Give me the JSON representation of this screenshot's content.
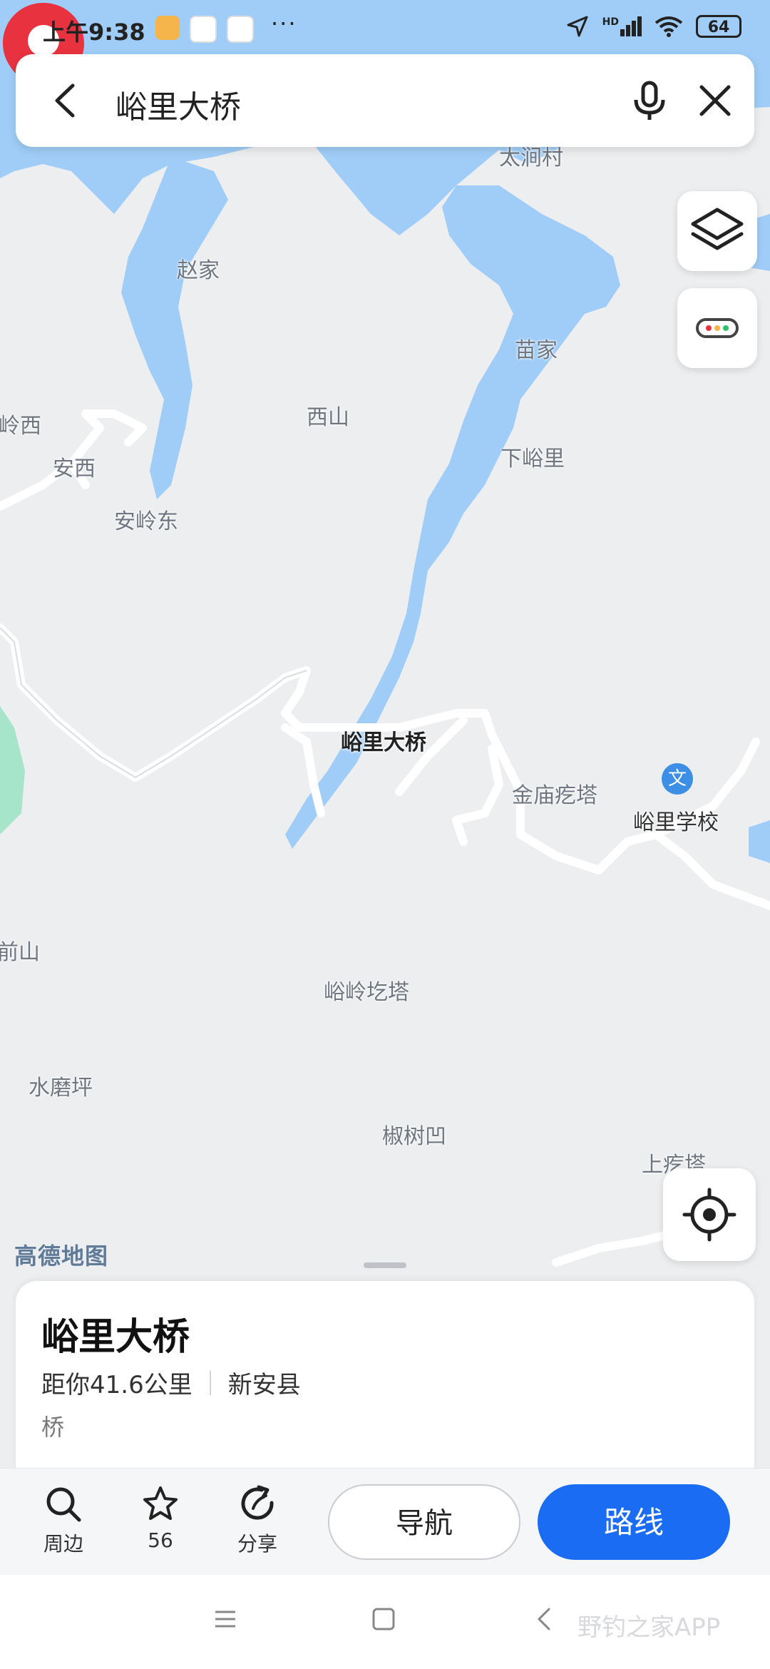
{
  "status_bar": {
    "time": "上午9:38",
    "dots": "···",
    "network": "HD",
    "battery": "64"
  },
  "search": {
    "query": "峪里大桥"
  },
  "map": {
    "places": [
      "太涧村",
      "赵家",
      "苗家",
      "岭西",
      "西山",
      "安西",
      "下峪里",
      "安岭东",
      "金庙疙塔",
      "峪里学校",
      "前山",
      "峪岭圪塔",
      "水磨坪",
      "椒树凹",
      "上疙塔"
    ],
    "pin_label": "峪里大桥",
    "logo": "高德地图",
    "school_icon": "文"
  },
  "card": {
    "title": "峪里大桥",
    "distance": "距你41.6公里",
    "region": "新安县",
    "category": "桥"
  },
  "actions": {
    "nearby": "周边",
    "favorite_count": "56",
    "share": "分享",
    "navigate": "导航",
    "route": "路线"
  },
  "watermark": "野钓之家APP",
  "colors": {
    "water": "#9fcdf7",
    "accent": "#1a6cf3",
    "pin": "#e8323f",
    "green": "#a6e5c9"
  }
}
